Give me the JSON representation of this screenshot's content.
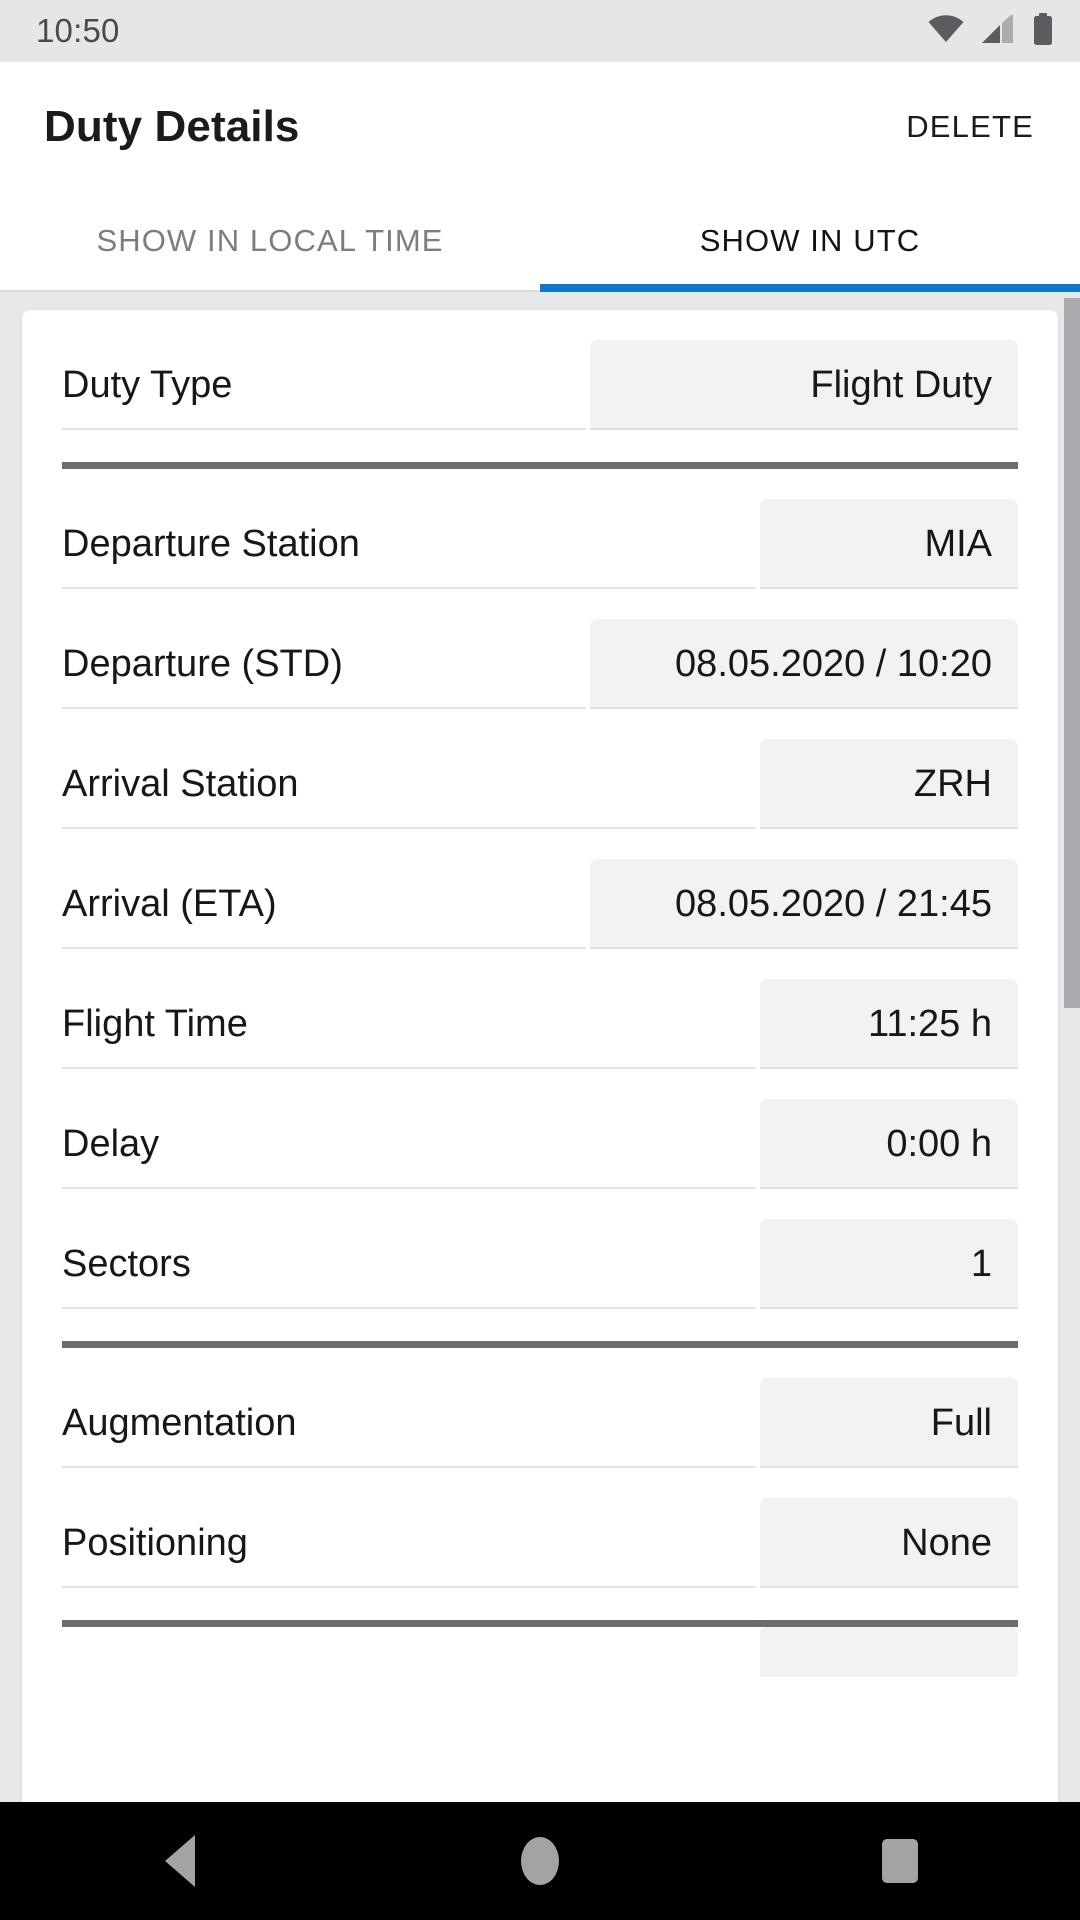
{
  "status_bar": {
    "clock": "10:50",
    "icons": [
      "wifi-icon",
      "cellular-signal-icon",
      "battery-icon"
    ]
  },
  "app_bar": {
    "title": "Duty Details",
    "action_label": "DELETE"
  },
  "tabs": [
    {
      "label": "SHOW IN LOCAL TIME",
      "active": false
    },
    {
      "label": "SHOW IN UTC",
      "active": true
    }
  ],
  "colors": {
    "accent": "#0e78ce",
    "status_bar_bg": "#e5e6e8",
    "page_bg": "#e7e8ea",
    "field_bg": "#f1f2f4",
    "section_divider": "#6b6d70",
    "nav_icon": "#a2a3a5"
  },
  "form": {
    "sections": [
      {
        "rows": [
          {
            "label": "Duty Type",
            "value": "Flight Duty",
            "width": "wide"
          }
        ]
      },
      {
        "rows": [
          {
            "label": "Departure Station",
            "value": "MIA",
            "width": "narrow"
          },
          {
            "label": "Departure (STD)",
            "value": "08.05.2020 / 10:20",
            "width": "wide"
          },
          {
            "label": "Arrival Station",
            "value": "ZRH",
            "width": "narrow"
          },
          {
            "label": "Arrival (ETA)",
            "value": "08.05.2020 / 21:45",
            "width": "wide"
          },
          {
            "label": "Flight Time",
            "value": "11:25 h",
            "width": "narrow"
          },
          {
            "label": "Delay",
            "value": "0:00 h",
            "width": "narrow"
          },
          {
            "label": "Sectors",
            "value": "1",
            "width": "narrow"
          }
        ]
      },
      {
        "rows": [
          {
            "label": "Augmentation",
            "value": "Full",
            "width": "narrow"
          },
          {
            "label": "Positioning",
            "value": "None",
            "width": "narrow"
          }
        ]
      },
      {
        "rows": [
          {
            "label": "",
            "value": "",
            "width": "narrow"
          }
        ]
      }
    ]
  },
  "nav_bar": {
    "buttons": [
      "back-icon",
      "home-icon",
      "recents-icon"
    ]
  }
}
